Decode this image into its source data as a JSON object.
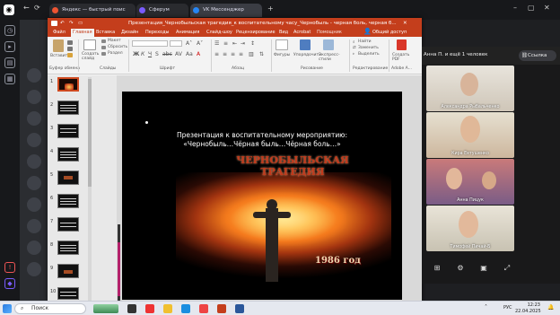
{
  "browser": {
    "tabs": [
      {
        "label": "Яндекс — быстрый поис"
      },
      {
        "label": "Сферум"
      },
      {
        "label": "VK Мессенджер"
      }
    ],
    "new_tab": "+"
  },
  "powerpoint": {
    "title": "Презентация_Чернобыльская трагедия_к воспитательному часу_Чернобыль - черная боль, черная б...",
    "ribbon_tabs": [
      "Файл",
      "Главная",
      "Вставка",
      "Дизайн",
      "Переходы",
      "Анимация",
      "Слайд-шоу",
      "Рецензирование",
      "Вид",
      "Acrobat",
      "Помощник"
    ],
    "share": "Общий доступ",
    "groups": {
      "clipboard": {
        "label": "Буфер обмена",
        "paste": "Вставить"
      },
      "slides": {
        "label": "Слайды",
        "create": "Создать слайд",
        "layout": "Макет",
        "reset": "Сбросить",
        "section": "Раздел"
      },
      "font": {
        "label": "Шрифт"
      },
      "paragraph": {
        "label": "Абзац"
      },
      "drawing": {
        "label": "Рисование",
        "shapes": "Фигуры",
        "arrange": "Упорядочить",
        "quick_styles": "Экспресс-стили"
      },
      "editing": {
        "label": "Редактирование",
        "find": "Найти",
        "replace": "Заменить",
        "select": "Выделить"
      },
      "adobe": {
        "label": "Adobe A...",
        "create_pdf": "Создать PDF"
      }
    },
    "slide_numbers": [
      "1",
      "2",
      "3",
      "4",
      "5",
      "6",
      "7",
      "8",
      "9",
      "10"
    ],
    "slide": {
      "subtitle_line1": "Презентация к воспитательному мероприятию:",
      "subtitle_line2": "«Чернобыль…Чёрная быль…Чёрная боль…»",
      "title_line1": "ЧЕРНОБЫЛЬСКАЯ",
      "title_line2": "ТРАГЕДИЯ",
      "year": "1986 год"
    }
  },
  "vk": {
    "header": "Анна П. и ещё 1 человек",
    "link_button": "Ссылка",
    "participants": [
      "Александра Рыбальченко",
      "Кира Евтушенко",
      "Анна Пицук",
      "Тимофей Пичай-Б"
    ]
  },
  "taskbar": {
    "search_placeholder": "Поиск",
    "lang": "РУС",
    "time": "12:23",
    "date": "22.04.2025"
  }
}
